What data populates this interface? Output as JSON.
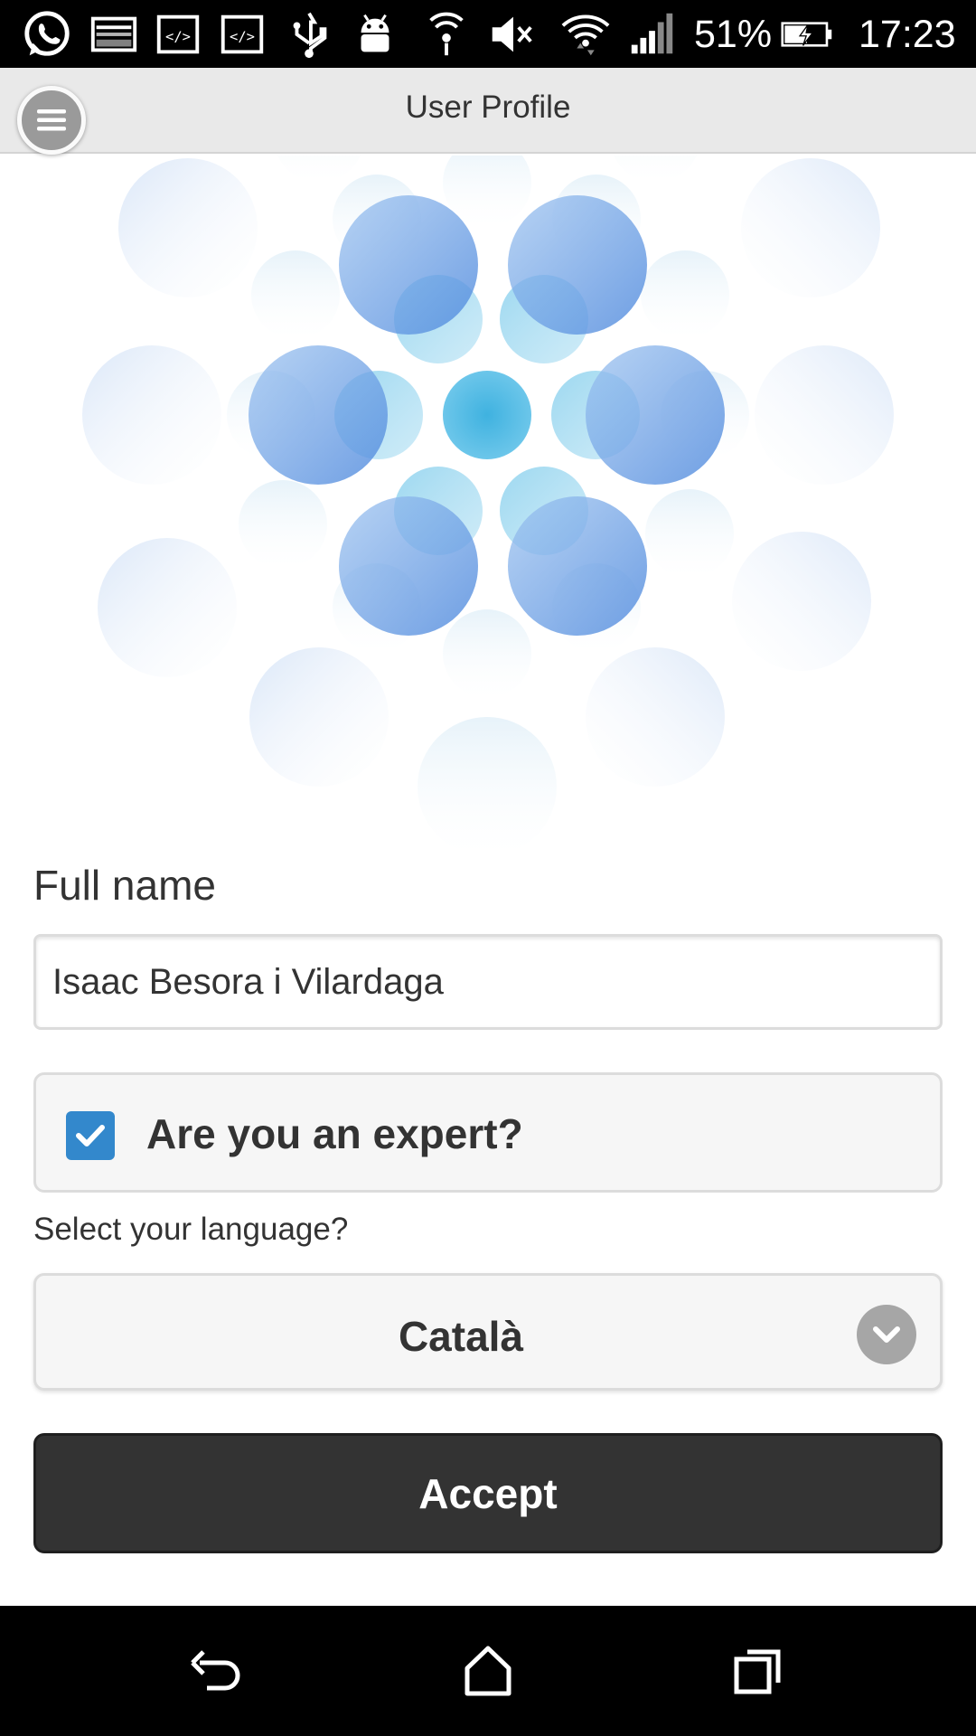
{
  "status_bar": {
    "battery": "51%",
    "time": "17:23",
    "icons": [
      "whatsapp-icon",
      "image-icon",
      "code-icon",
      "code-icon",
      "usb-icon",
      "android-icon",
      "hotspot-icon",
      "mute-icon",
      "wifi-icon",
      "signal-icon",
      "battery-charging-icon"
    ]
  },
  "header": {
    "title": "User Profile",
    "menu_icon": "menu-icon"
  },
  "form": {
    "full_name_label": "Full name",
    "full_name_value": "Isaac Besora i Vilardaga",
    "expert_label": "Are you an expert?",
    "expert_checked": true,
    "language_label": "Select your language?",
    "language_value": "Català",
    "accept_label": "Accept"
  },
  "colors": {
    "accent": "#3388cc",
    "button_dark": "#333333",
    "bubble_blue": "#4a90e2",
    "bubble_cyan": "#3fb4e0"
  },
  "nav_bar": {
    "icons": [
      "back-icon",
      "home-icon",
      "recents-icon"
    ]
  }
}
